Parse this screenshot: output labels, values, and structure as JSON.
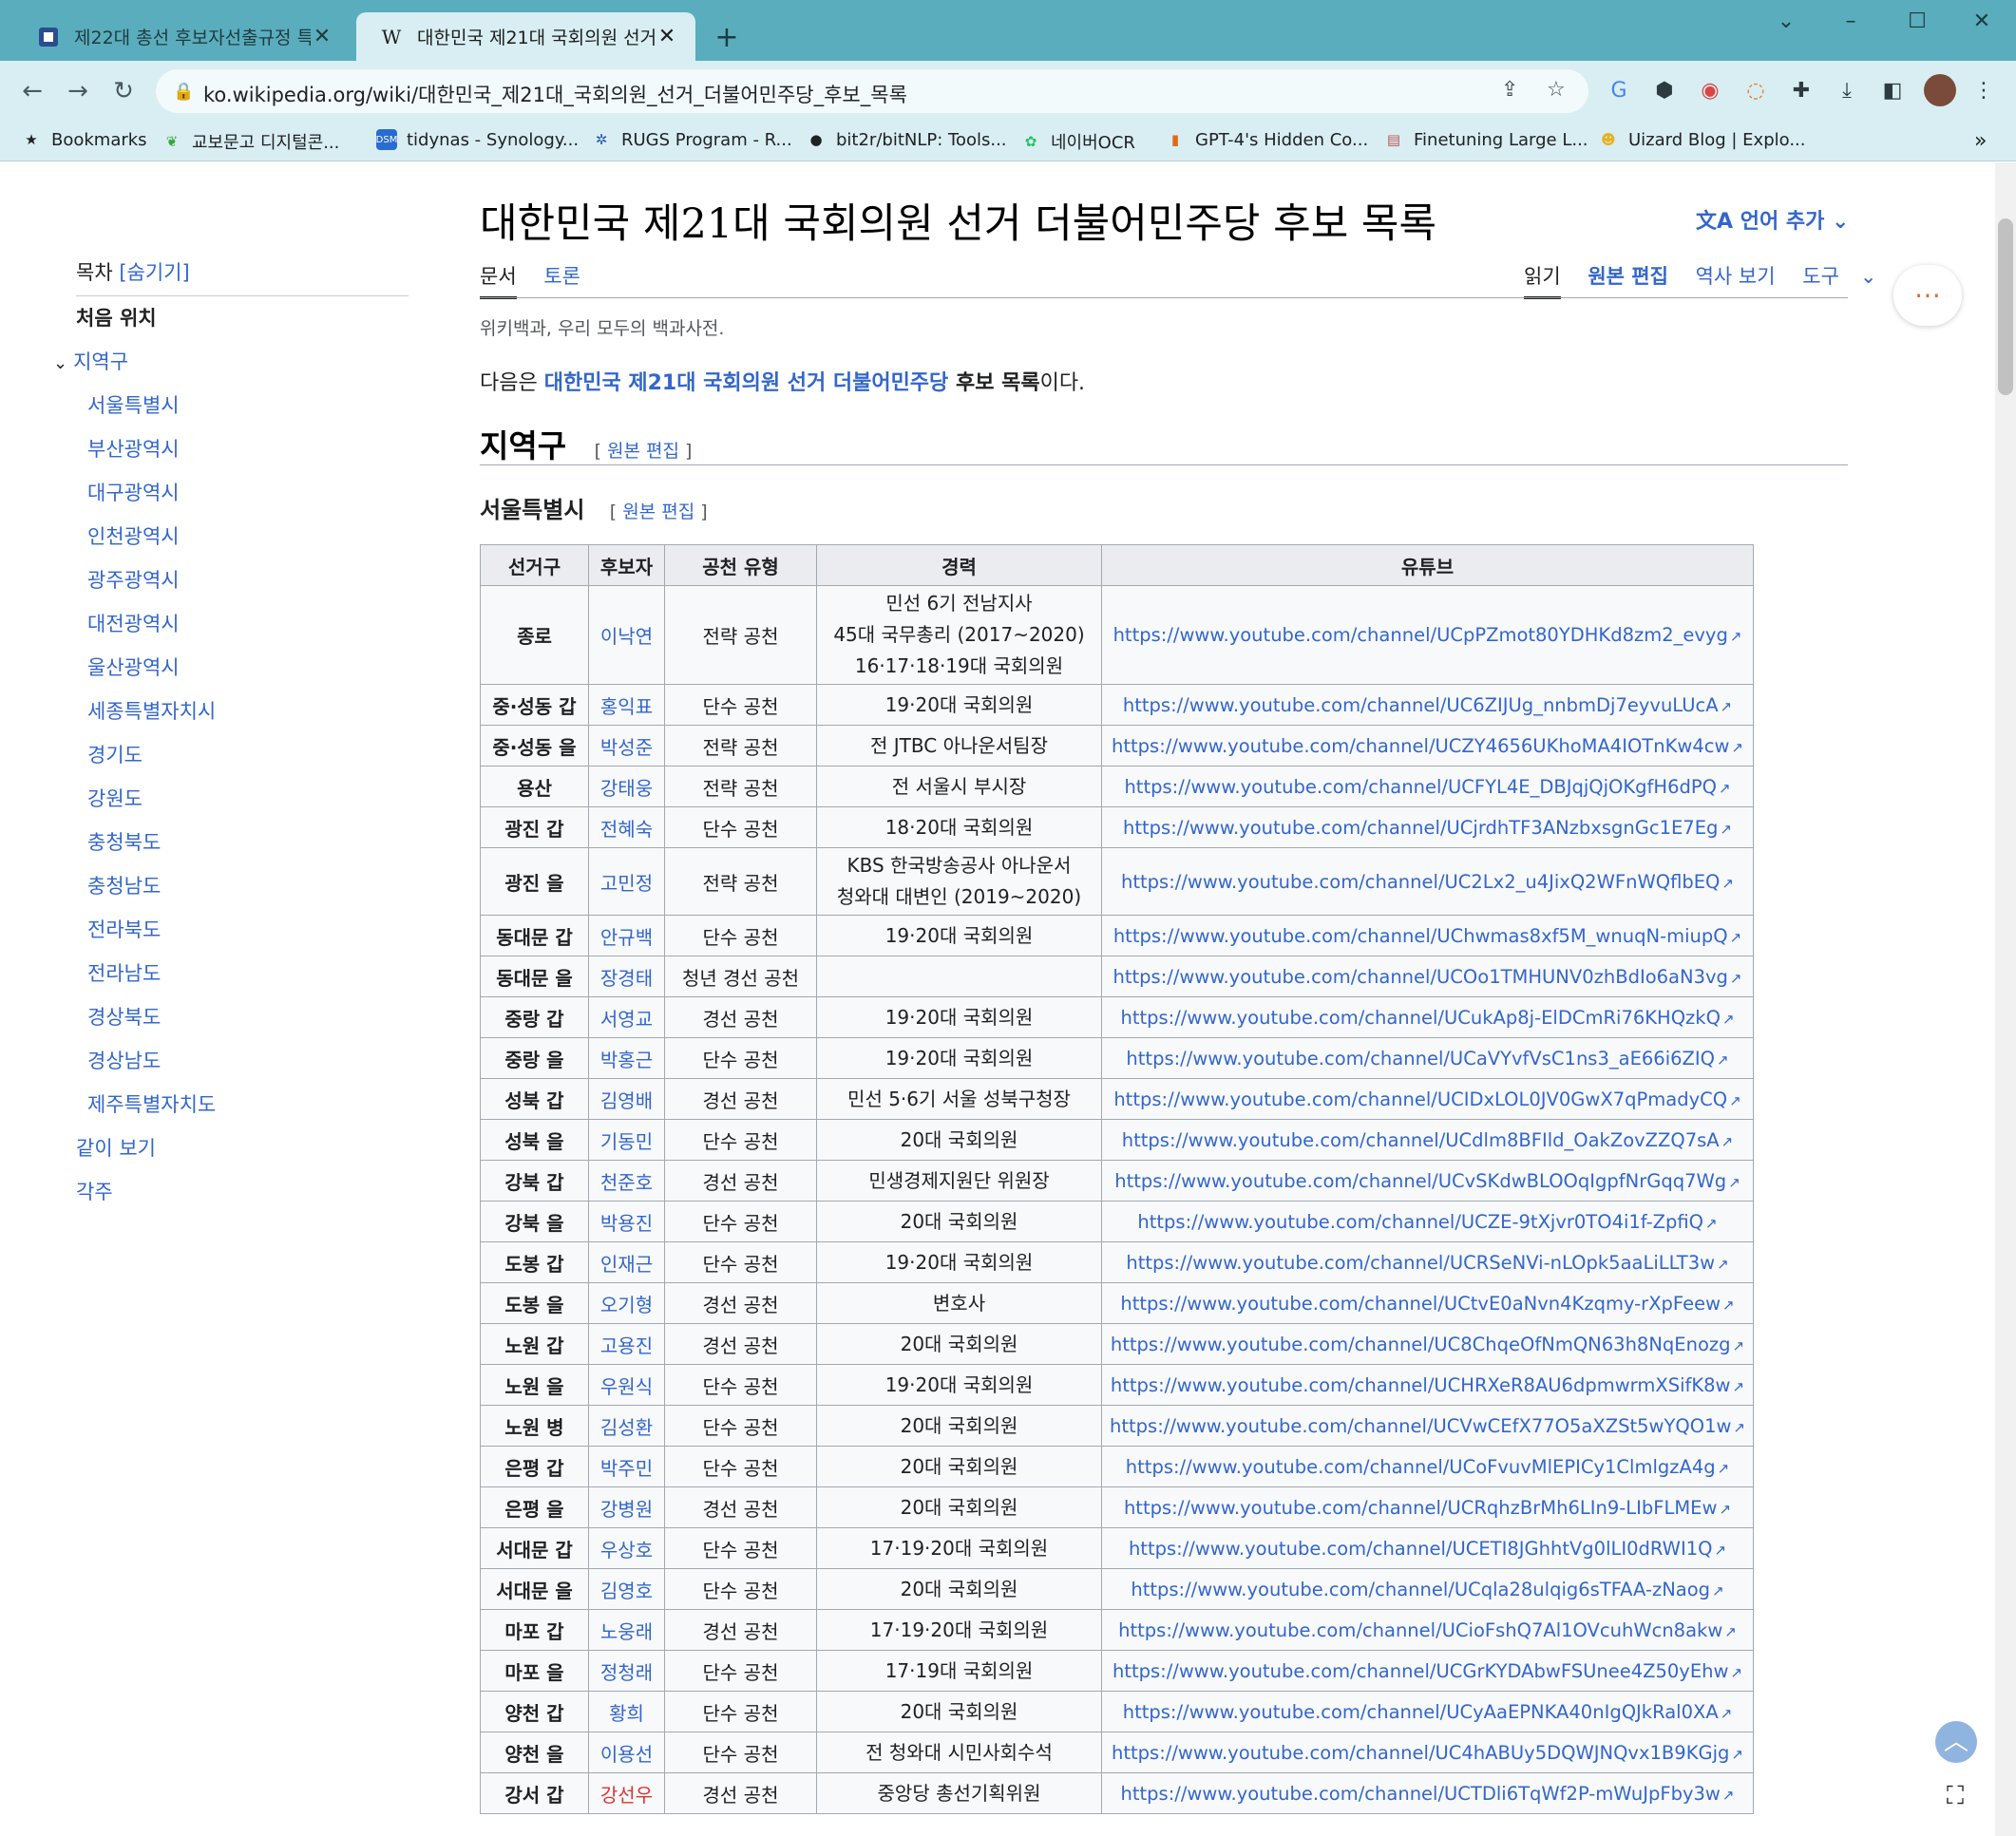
{
  "browser": {
    "tabs": [
      {
        "title": "제22대 총선 후보자선출규정 특",
        "active": false
      },
      {
        "title": "대한민국 제21대 국회의원 선거",
        "active": true
      }
    ],
    "url": "ko.wikipedia.org/wiki/대한민국_제21대_국회의원_선거_더불어민주당_후보_목록",
    "bookmarks": [
      "Bookmarks",
      "교보문고 디지털콘...",
      "tidynas - Synology...",
      "RUGS Program - R...",
      "bit2r/bitNLP: Tools...",
      "네이버OCR",
      "GPT-4's Hidden Co...",
      "Finetuning Large L...",
      "Uizard Blog | Explo..."
    ]
  },
  "toc": {
    "title": "목차",
    "hide": "[숨기기]",
    "top": "처음 위치",
    "section": "지역구",
    "subsections": [
      "서울특별시",
      "부산광역시",
      "대구광역시",
      "인천광역시",
      "광주광역시",
      "대전광역시",
      "울산광역시",
      "세종특별자치시",
      "경기도",
      "강원도",
      "충청북도",
      "충청남도",
      "전라북도",
      "전라남도",
      "경상북도",
      "경상남도",
      "제주특별자치도"
    ],
    "see_also": "같이 보기",
    "notes": "각주"
  },
  "article": {
    "title": "대한민국 제21대 국회의원 선거 더불어민주당 후보 목록",
    "lang_button": "언어 추가",
    "tab_article": "문서",
    "tab_talk": "토론",
    "tab_read": "읽기",
    "tab_edit": "원본 편집",
    "tab_history": "역사 보기",
    "tab_tools": "도구",
    "tagline": "위키백과, 우리 모두의 백과사전.",
    "intro_pre": "다음은 ",
    "intro_link": "대한민국 제21대 국회의원 선거 더불어민주당",
    "intro_bold": " 후보 목록",
    "intro_post": "이다.",
    "h2": "지역구",
    "h3": "서울특별시",
    "edit_label": "원본 편집"
  },
  "table": {
    "headers": [
      "선거구",
      "후보자",
      "공천 유형",
      "경력",
      "유튜브"
    ],
    "rows": [
      {
        "d": "종로",
        "c": "이낙연",
        "t": "전략 공천",
        "k": [
          "민선 6기 전남지사",
          "45대 국무총리 (2017~2020)",
          "16·17·18·19대 국회의원"
        ],
        "y": "https://www.youtube.com/channel/UCpPZmot80YDHKd8zm2_evyg"
      },
      {
        "d": "중·성동 갑",
        "c": "홍익표",
        "t": "단수 공천",
        "k": [
          "19·20대 국회의원"
        ],
        "y": "https://www.youtube.com/channel/UC6ZIJUg_nnbmDj7eyvuLUcA"
      },
      {
        "d": "중·성동 을",
        "c": "박성준",
        "t": "전략 공천",
        "k": [
          "전 JTBC 아나운서팀장"
        ],
        "y": "https://www.youtube.com/channel/UCZY4656UKhoMA4IOTnKw4cw"
      },
      {
        "d": "용산",
        "c": "강태웅",
        "t": "전략 공천",
        "k": [
          "전 서울시 부시장"
        ],
        "y": "https://www.youtube.com/channel/UCFYL4E_DBJqjQjOKgfH6dPQ"
      },
      {
        "d": "광진 갑",
        "c": "전혜숙",
        "t": "단수 공천",
        "k": [
          "18·20대 국회의원"
        ],
        "y": "https://www.youtube.com/channel/UCjrdhTF3ANzbxsgnGc1E7Eg"
      },
      {
        "d": "광진 을",
        "c": "고민정",
        "t": "전략 공천",
        "k": [
          "KBS 한국방송공사 아나운서",
          "청와대 대변인 (2019~2020)"
        ],
        "y": "https://www.youtube.com/channel/UC2Lx2_u4JixQ2WFnWQflbEQ"
      },
      {
        "d": "동대문 갑",
        "c": "안규백",
        "t": "단수 공천",
        "k": [
          "19·20대 국회의원"
        ],
        "y": "https://www.youtube.com/channel/UChwmas8xf5M_wnuqN-miupQ"
      },
      {
        "d": "동대문 을",
        "c": "장경태",
        "t": "청년 경선 공천",
        "k": [
          ""
        ],
        "y": "https://www.youtube.com/channel/UCOo1TMHUNV0zhBdIo6aN3vg"
      },
      {
        "d": "중랑 갑",
        "c": "서영교",
        "t": "경선 공천",
        "k": [
          "19·20대 국회의원"
        ],
        "y": "https://www.youtube.com/channel/UCukAp8j-ElDCmRi76KHQzkQ"
      },
      {
        "d": "중랑 을",
        "c": "박홍근",
        "t": "단수 공천",
        "k": [
          "19·20대 국회의원"
        ],
        "y": "https://www.youtube.com/channel/UCaVYvfVsC1ns3_aE66i6ZIQ"
      },
      {
        "d": "성북 갑",
        "c": "김영배",
        "t": "경선 공천",
        "k": [
          "민선 5·6기 서울 성북구청장"
        ],
        "y": "https://www.youtube.com/channel/UCIDxLOL0JV0GwX7qPmadyCQ"
      },
      {
        "d": "성북 을",
        "c": "기동민",
        "t": "단수 공천",
        "k": [
          "20대 국회의원"
        ],
        "y": "https://www.youtube.com/channel/UCdlm8BFIld_OakZovZZQ7sA"
      },
      {
        "d": "강북 갑",
        "c": "천준호",
        "t": "경선 공천",
        "k": [
          "민생경제지원단 위원장"
        ],
        "y": "https://www.youtube.com/channel/UCvSKdwBLOOqIgpfNrGqq7Wg"
      },
      {
        "d": "강북 을",
        "c": "박용진",
        "t": "단수 공천",
        "k": [
          "20대 국회의원"
        ],
        "y": "https://www.youtube.com/channel/UCZE-9tXjvr0TO4i1f-ZpfiQ"
      },
      {
        "d": "도봉 갑",
        "c": "인재근",
        "t": "단수 공천",
        "k": [
          "19·20대 국회의원"
        ],
        "y": "https://www.youtube.com/channel/UCRSeNVi-nLOpk5aaLiLLT3w"
      },
      {
        "d": "도봉 을",
        "c": "오기형",
        "t": "경선 공천",
        "k": [
          "변호사"
        ],
        "y": "https://www.youtube.com/channel/UCtvE0aNvn4Kzqmy-rXpFeew"
      },
      {
        "d": "노원 갑",
        "c": "고용진",
        "t": "경선 공천",
        "k": [
          "20대 국회의원"
        ],
        "y": "https://www.youtube.com/channel/UC8ChqeOfNmQN63h8NqEnozg"
      },
      {
        "d": "노원 을",
        "c": "우원식",
        "t": "단수 공천",
        "k": [
          "19·20대 국회의원"
        ],
        "y": "https://www.youtube.com/channel/UCHRXeR8AU6dpmwrmXSifK8w"
      },
      {
        "d": "노원 병",
        "c": "김성환",
        "t": "단수 공천",
        "k": [
          "20대 국회의원"
        ],
        "y": "https://www.youtube.com/channel/UCVwCEfX77O5aXZSt5wYQO1w"
      },
      {
        "d": "은평 갑",
        "c": "박주민",
        "t": "단수 공천",
        "k": [
          "20대 국회의원"
        ],
        "y": "https://www.youtube.com/channel/UCoFvuvMlEPICy1ClmlgzA4g"
      },
      {
        "d": "은평 을",
        "c": "강병원",
        "t": "경선 공천",
        "k": [
          "20대 국회의원"
        ],
        "y": "https://www.youtube.com/channel/UCRqhzBrMh6LIn9-LIbFLMEw"
      },
      {
        "d": "서대문 갑",
        "c": "우상호",
        "t": "단수 공천",
        "k": [
          "17·19·20대 국회의원"
        ],
        "y": "https://www.youtube.com/channel/UCETI8JGhhtVg0lLI0dRWI1Q"
      },
      {
        "d": "서대문 을",
        "c": "김영호",
        "t": "단수 공천",
        "k": [
          "20대 국회의원"
        ],
        "y": "https://www.youtube.com/channel/UCqla28ulqig6sTFAA-zNaog"
      },
      {
        "d": "마포 갑",
        "c": "노웅래",
        "t": "경선 공천",
        "k": [
          "17·19·20대 국회의원"
        ],
        "y": "https://www.youtube.com/channel/UCioFshQ7Al1OVcuhWcn8akw"
      },
      {
        "d": "마포 을",
        "c": "정청래",
        "t": "단수 공천",
        "k": [
          "17·19대 국회의원"
        ],
        "y": "https://www.youtube.com/channel/UCGrKYDAbwFSUnee4Z50yEhw"
      },
      {
        "d": "양천 갑",
        "c": "황희",
        "t": "단수 공천",
        "k": [
          "20대 국회의원"
        ],
        "y": "https://www.youtube.com/channel/UCyAaEPNKA40nIgQJkRal0XA"
      },
      {
        "d": "양천 을",
        "c": "이용선",
        "t": "단수 공천",
        "k": [
          "전 청와대 시민사회수석"
        ],
        "y": "https://www.youtube.com/channel/UC4hABUy5DQWJNQvx1B9KGjg"
      },
      {
        "d": "강서 갑",
        "c": "강선우",
        "t": "경선 공천",
        "k": [
          "중앙당 총선기획위원"
        ],
        "y": "https://www.youtube.com/channel/UCTDli6TqWf2P-mWuJpFby3w",
        "red": true
      }
    ]
  }
}
